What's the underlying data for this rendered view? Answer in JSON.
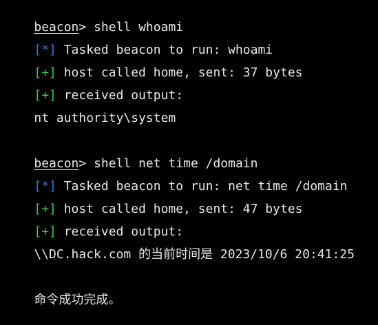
{
  "colors": {
    "background": "#000000",
    "text": "#e8e8e8",
    "task_marker": "#2f74f6",
    "ok_marker": "#3ccf3c"
  },
  "session1": {
    "prompt": "beacon",
    "arrow": ">",
    "command": " shell whoami",
    "task_marker": "[*]",
    "task_text": " Tasked beacon to run: whoami",
    "sent_marker": "[+]",
    "sent_text": " host called home, sent: 37 bytes",
    "recv_marker": "[+]",
    "recv_text": " received output:",
    "output": "nt authority\\system"
  },
  "session2": {
    "prompt": "beacon",
    "arrow": ">",
    "command": " shell net time /domain",
    "task_marker": "[*]",
    "task_text": " Tasked beacon to run: net time /domain",
    "sent_marker": "[+]",
    "sent_text": " host called home, sent: 47 bytes",
    "recv_marker": "[+]",
    "recv_text": " received output:",
    "output": "\\\\DC.hack.com 的当前时间是 2023/10/6 20:41:25",
    "completion": "命令成功完成。"
  }
}
